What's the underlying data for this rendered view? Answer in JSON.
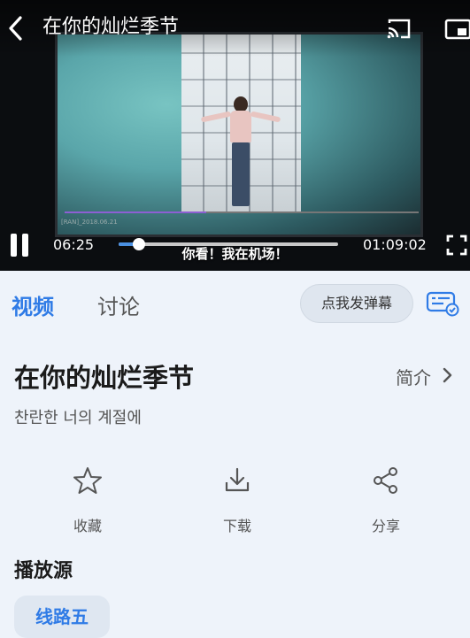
{
  "player": {
    "title": "在你的灿烂季节",
    "current_time": "06:25",
    "total_time": "01:09:02",
    "progress": 0.091,
    "subtitle": "你看！我在机场！",
    "inner_progress": 0.4,
    "inner_caption": "[RAN]_2018.06.21"
  },
  "tabs": [
    {
      "label": "视频",
      "active": true
    },
    {
      "label": "讨论",
      "active": false
    }
  ],
  "danmaku_button": "点我发弹幕",
  "show": {
    "title": "在你的灿烂季节",
    "intro_label": "简介",
    "original_title": "찬란한 너의 계절에"
  },
  "actions": [
    {
      "label": "收藏",
      "icon": "star-icon"
    },
    {
      "label": "下载",
      "icon": "download-icon"
    },
    {
      "label": "分享",
      "icon": "share-icon"
    }
  ],
  "source_section": {
    "title": "播放源",
    "sources": [
      "线路五"
    ]
  },
  "colors": {
    "accent": "#2f7be6",
    "background": "#eef3fa",
    "player_bg": "#0b0d10"
  }
}
